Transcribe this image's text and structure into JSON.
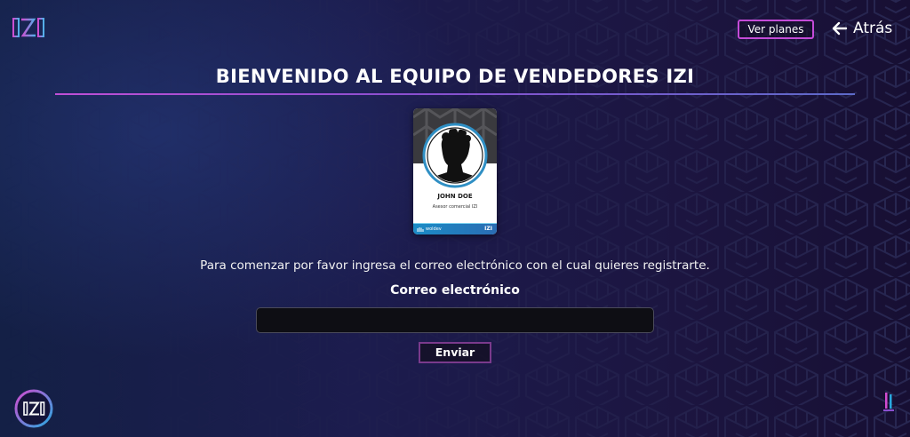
{
  "header": {
    "logo_text": "IZI",
    "plans_button": "Ver planes",
    "back_label": "Atrás"
  },
  "main": {
    "title": "BIENVENIDO AL EQUIPO DE VENDEDORES IZI",
    "card": {
      "name": "JOHN DOE",
      "role": "Asesor comercial IZI",
      "footer_brand": "woldev",
      "footer_logo": "IZI"
    },
    "instructions": "Para comenzar por favor ingresa el correo electrónico con el cual quieres registrarte.",
    "email_label": "Correo electrónico",
    "email_value": "",
    "send_button": "Enviar"
  },
  "footer": {
    "badge_text": "IZI"
  },
  "colors": {
    "accent_magenta": "#c44bd8",
    "accent_blue": "#29a9e0",
    "background_dark": "#1c1c4e"
  }
}
